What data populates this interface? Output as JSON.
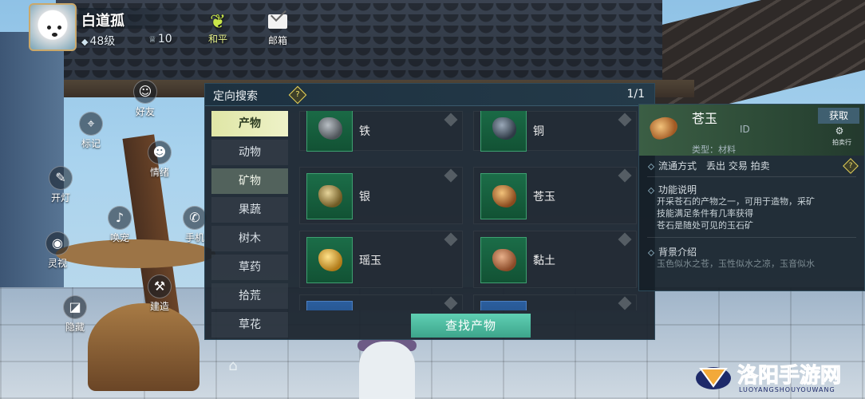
{
  "player": {
    "name": "白道孤",
    "level": "48级",
    "count": "10",
    "peace_label": "和平",
    "mail_label": "邮箱"
  },
  "side_buttons": [
    {
      "label": "好友",
      "icon": "friend-icon"
    },
    {
      "label": "标记",
      "icon": "marker-icon"
    },
    {
      "label": "情绪",
      "icon": "emotion-icon"
    },
    {
      "label": "开灯",
      "icon": "light-icon"
    },
    {
      "label": "唤宠",
      "icon": "whistle-icon"
    },
    {
      "label": "手机",
      "icon": "phone-icon"
    },
    {
      "label": "灵视",
      "icon": "camera-icon"
    },
    {
      "label": "建造",
      "icon": "hammer-icon"
    },
    {
      "label": "隐藏",
      "icon": "hide-icon"
    }
  ],
  "panel": {
    "title": "定向搜索",
    "help": "?",
    "page": "1/1",
    "categories": [
      "产物",
      "动物",
      "矿物",
      "果蔬",
      "树木",
      "草药",
      "拾荒",
      "草花"
    ],
    "items": [
      {
        "name": "铁",
        "color": "#8a8f94"
      },
      {
        "name": "铜",
        "color": "#5d6a78"
      },
      {
        "name": "银",
        "color": "#b59a4c"
      },
      {
        "name": "苍玉",
        "color": "#c48a48"
      },
      {
        "name": "瑶玉",
        "color": "#e0b040"
      },
      {
        "name": "黏土",
        "color": "#c98c5a"
      },
      {
        "name": "",
        "color": "#d0a050"
      },
      {
        "name": "",
        "color": "#b07a3a"
      }
    ],
    "search_button": "查找产物"
  },
  "detail": {
    "name": "苍玉",
    "id_label": "ID",
    "type": "类型：材料",
    "obtain_button": "获取",
    "auction_label": "拍卖行",
    "circulation": "流通方式　丢出 交易 拍卖",
    "func_title": "功能说明",
    "func_lines": [
      "开采苍石的产物之一，可用于造物，采矿",
      "技能满足条件有几率获得",
      "苍石是随处可见的玉石矿"
    ],
    "bg_title": "背景介绍",
    "bg_line": "玉色似水之苍，玉性似水之凉，玉音似水"
  },
  "watermark": {
    "text": "洛阳手游网",
    "sub": "LUOYANGSHOUYOUWANG"
  }
}
